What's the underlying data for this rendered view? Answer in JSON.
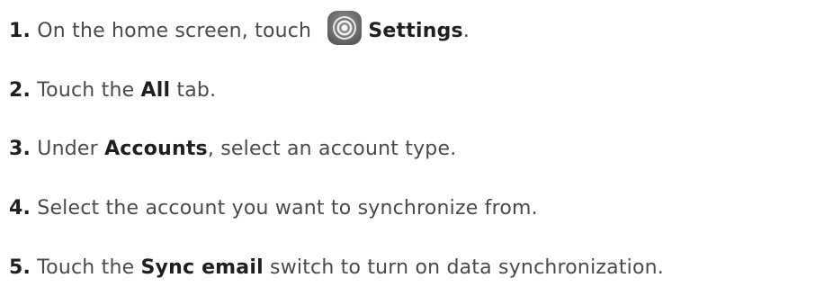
{
  "steps": [
    {
      "number": "1.",
      "pre": "On the home screen, touch ",
      "icon": "settings-gear-icon",
      "term": "Settings",
      "post": "."
    },
    {
      "number": "2.",
      "pre": "Touch the ",
      "term": "All",
      "post": " tab."
    },
    {
      "number": "3.",
      "pre": "Under ",
      "term": "Accounts",
      "post": ", select an account type."
    },
    {
      "number": "4.",
      "text": "Select the account you want to synchronize from."
    },
    {
      "number": "5.",
      "pre": "Touch the ",
      "term": "Sync email",
      "post": " switch to turn on data synchronization."
    }
  ],
  "colors": {
    "text": "#4a4a4a",
    "emphasis": "#1f1f1f",
    "icon_ring": "#9a9a9a",
    "icon_bg": "#6f6f6f"
  }
}
